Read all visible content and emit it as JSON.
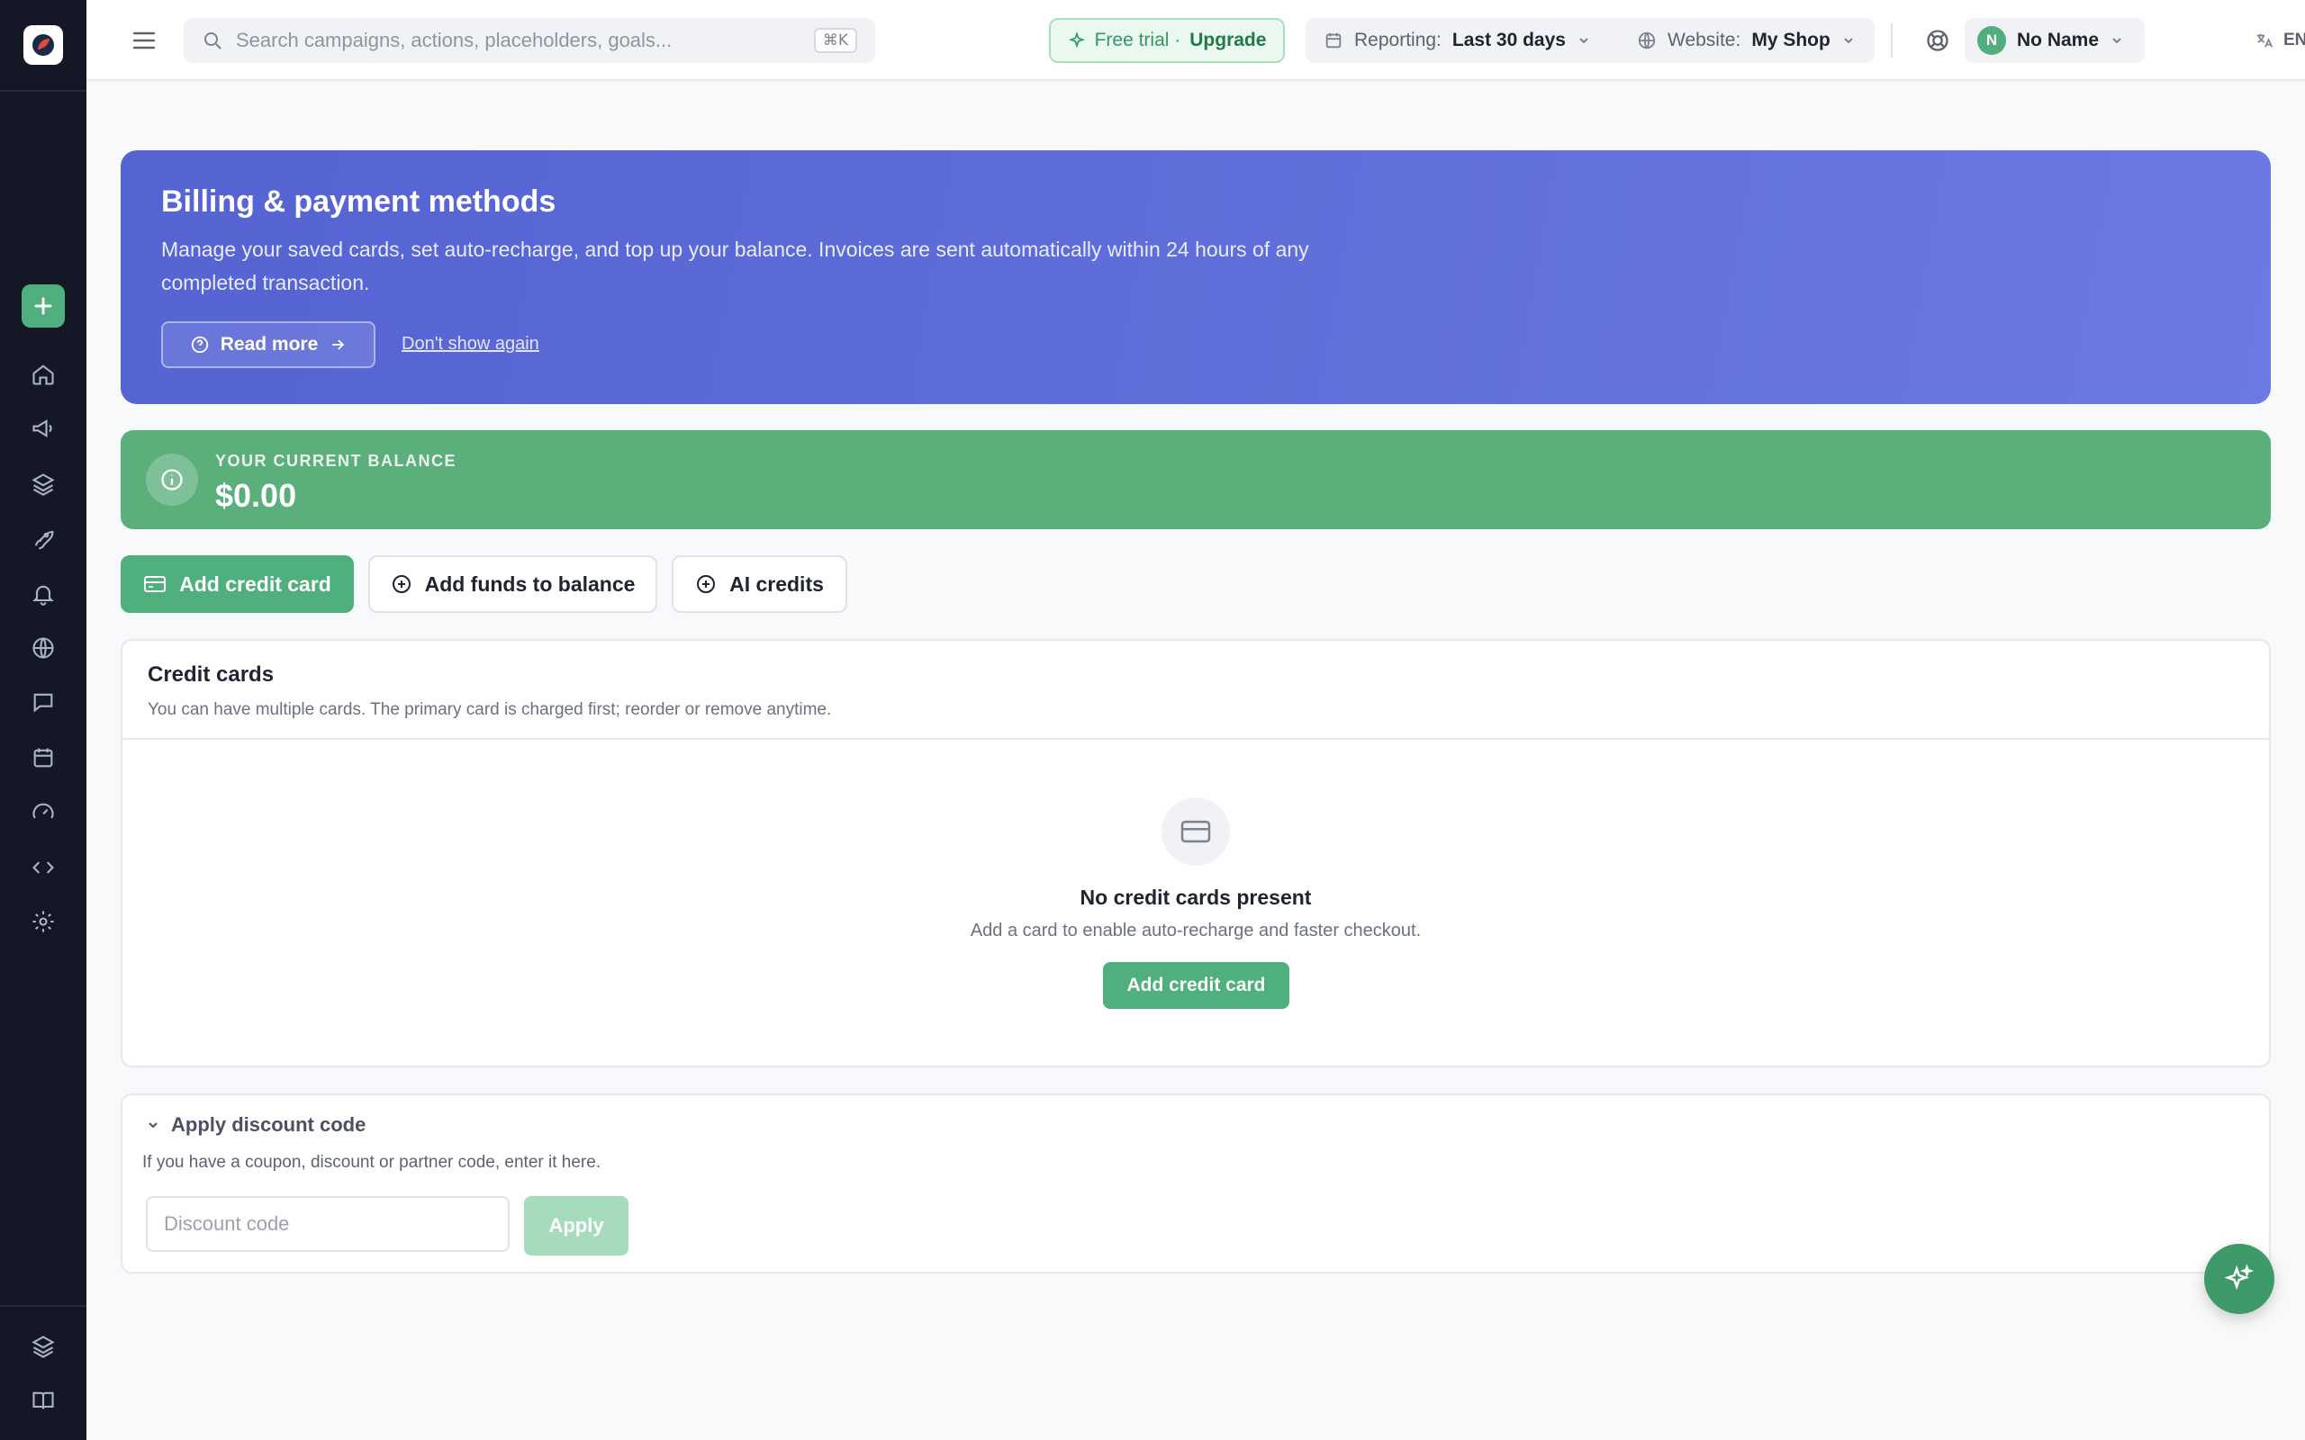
{
  "sidebar": {
    "icons": [
      "home-icon",
      "megaphone-icon",
      "layers-icon",
      "rocket-icon",
      "bell-icon",
      "globe-icon",
      "chat-icon",
      "calendar-icon",
      "gauge-icon",
      "code-icon",
      "gear-icon"
    ],
    "bottom_icons": [
      "layers-icon",
      "book-icon"
    ]
  },
  "topbar": {
    "search_placeholder": "Search campaigns, actions, placeholders, goals...",
    "search_shortcut": "⌘K",
    "trial_label": "Free trial ·",
    "trial_upgrade": "Upgrade",
    "reporting_label": "Reporting:",
    "reporting_value": "Last 30 days",
    "website_label": "Website:",
    "website_value": "My Shop",
    "user_initial": "N",
    "user_name": "No Name",
    "language": "EN"
  },
  "hero": {
    "title": "Billing & payment methods",
    "description": "Manage your saved cards, set auto-recharge, and top up your balance. Invoices are sent automatically within 24 hours of any completed transaction.",
    "read_more": "Read more",
    "dont_show": "Don't show again"
  },
  "balance": {
    "label": "YOUR CURRENT BALANCE",
    "value": "$0.00"
  },
  "actions": {
    "add_card": "Add credit card",
    "add_funds": "Add funds to balance",
    "ai_credits": "AI credits"
  },
  "credit_cards": {
    "title": "Credit cards",
    "subtitle": "You can have multiple cards. The primary card is charged first; reorder or remove anytime.",
    "empty_title": "No credit cards present",
    "empty_subtitle": "Add a card to enable auto-recharge and faster checkout.",
    "empty_button": "Add credit card"
  },
  "discount": {
    "title": "Apply discount code",
    "subtitle": "If you have a coupon, discount or partner code, enter it here.",
    "placeholder": "Discount code",
    "apply": "Apply"
  },
  "colors": {
    "sidebar": "#141826",
    "accent_green": "#4fb07e",
    "hero_blue": "#5563d3",
    "balance_green": "#5aaf7b"
  }
}
